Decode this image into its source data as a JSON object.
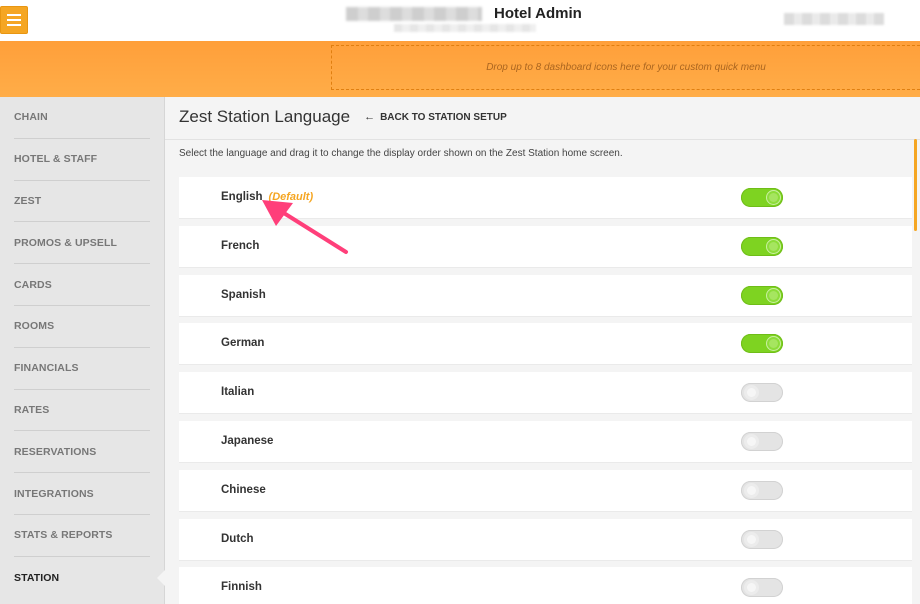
{
  "header": {
    "app_title": "Hotel Admin"
  },
  "quick_menu": {
    "hint": "Drop up to 8 dashboard icons here for your custom quick menu"
  },
  "sidebar": {
    "items": [
      {
        "label": "CHAIN"
      },
      {
        "label": "HOTEL & STAFF"
      },
      {
        "label": "ZEST"
      },
      {
        "label": "PROMOS & UPSELL"
      },
      {
        "label": "CARDS"
      },
      {
        "label": "ROOMS"
      },
      {
        "label": "FINANCIALS"
      },
      {
        "label": "RATES"
      },
      {
        "label": "RESERVATIONS"
      },
      {
        "label": "INTEGRATIONS"
      },
      {
        "label": "STATS & REPORTS"
      },
      {
        "label": "STATION"
      }
    ],
    "active": "STATION"
  },
  "page": {
    "title": "Zest Station Language",
    "back_label": "BACK TO STATION SETUP",
    "instructions": "Select the language and drag it to change the display order shown on the Zest Station home screen."
  },
  "languages": [
    {
      "name": "English",
      "default_label": "(Default)",
      "enabled": true
    },
    {
      "name": "French",
      "enabled": true
    },
    {
      "name": "Spanish",
      "enabled": true
    },
    {
      "name": "German",
      "enabled": true
    },
    {
      "name": "Italian",
      "enabled": false
    },
    {
      "name": "Japanese",
      "enabled": false
    },
    {
      "name": "Chinese",
      "enabled": false
    },
    {
      "name": "Dutch",
      "enabled": false
    },
    {
      "name": "Finnish",
      "enabled": false
    }
  ],
  "colors": {
    "accent": "#f5a623",
    "toggle_on": "#7ed321",
    "annotation_arrow": "#ff3f7a"
  }
}
